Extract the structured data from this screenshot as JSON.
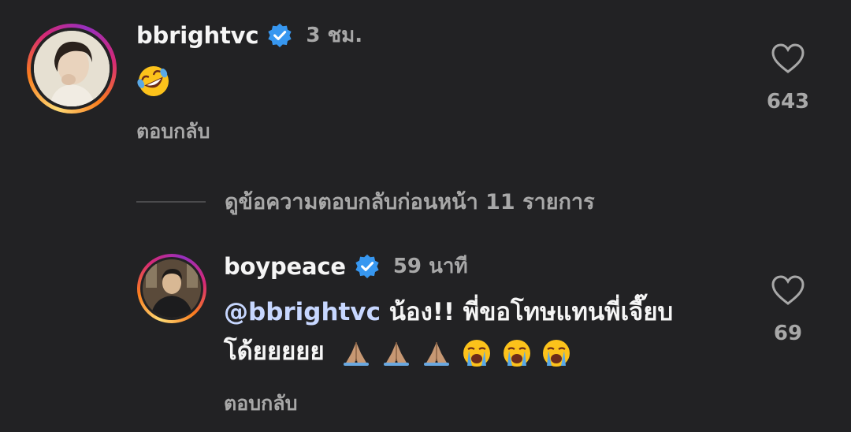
{
  "comments": [
    {
      "username": "bbrightvc",
      "time": "3 ชม.",
      "text": "",
      "reply_label": "ตอบกลับ",
      "likes": "643",
      "verified": true
    },
    {
      "username": "boypeace",
      "time": "59 นาที",
      "mention": "@bbrightvc",
      "text_line1": " น้อง!! พี่ขอโทษแทนพี่เจี๊ยบ",
      "text_line2": "โด้ยยยยย",
      "reply_label": "ตอบกลับ",
      "likes": "69",
      "verified": true
    }
  ],
  "view_previous_replies": "ดูข้อความตอบกลับก่อนหน้า 11 รายการ",
  "colors": {
    "background": "#222224",
    "verified_blue": "#3797f0",
    "mention": "#c7d7ff",
    "secondary_text": "#a8a8a8"
  },
  "icons": [
    "verified-badge-icon",
    "heart-outline-icon",
    "rofl-emoji",
    "folded-hands-emoji",
    "loudly-crying-emoji"
  ]
}
